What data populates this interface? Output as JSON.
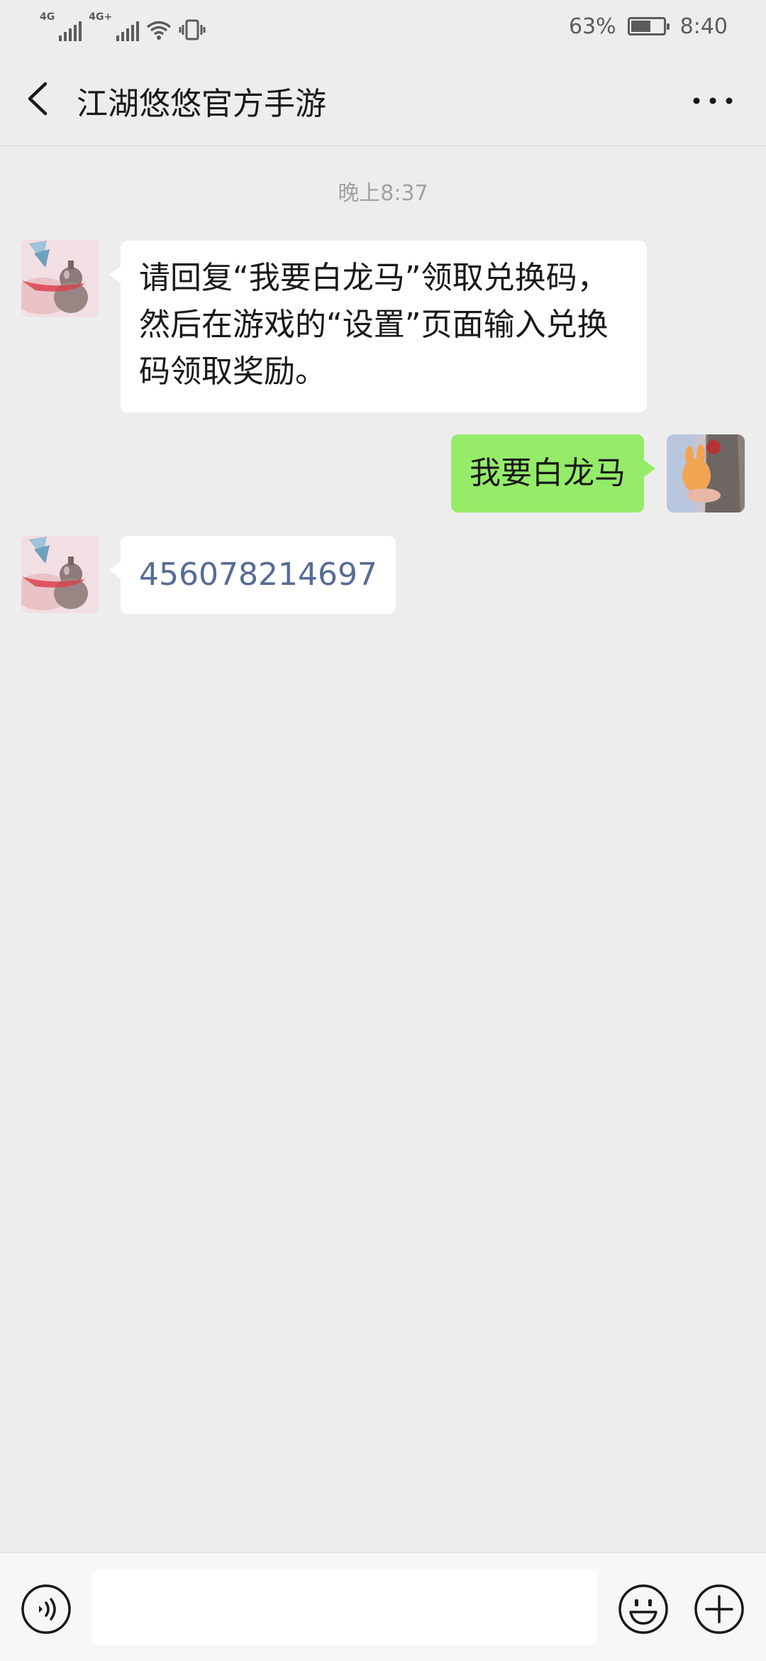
{
  "status_bar": {
    "network_1": "4G",
    "network_2": "4G+",
    "battery_percent": "63%",
    "battery_level": 0.63,
    "time": "8:40"
  },
  "header": {
    "title": "江湖悠悠官方手游"
  },
  "messages": {
    "timestamp": "晚上8:37",
    "items": [
      {
        "side": "left",
        "lines": [
          "请回复“我要白龙马”领取兑换码，",
          "然后在游戏的“设置”页面输入兑换",
          "码领取奖励。"
        ]
      },
      {
        "side": "right",
        "text": "我要白龙马"
      },
      {
        "side": "left",
        "text": "456078214697"
      }
    ]
  },
  "input_bar": {
    "value": ""
  },
  "colors": {
    "background": "#ededed",
    "sent_bubble": "#95ec69",
    "received_bubble": "#ffffff",
    "link_text": "#576b95"
  },
  "icons": [
    "back-arrow-icon",
    "more-dots-icon",
    "voice-icon",
    "emoji-icon",
    "plus-icon",
    "signal-icon",
    "wifi-icon",
    "vibrate-icon",
    "battery-icon"
  ]
}
